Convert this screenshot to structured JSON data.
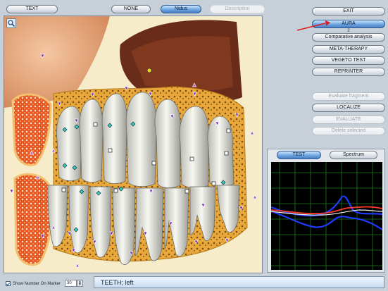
{
  "top_bar": {
    "text_button": "TEXT",
    "none_button": "NONE",
    "nidus_button": "Nidus",
    "description_button": "Description"
  },
  "right_menu": {
    "exit": "EXIT",
    "aura": "AURA",
    "aura_badge": "2",
    "comparative": "Comparative analysis",
    "meta_therapy": "META-THERAPY",
    "vegeto_test": "VEGETO TEST",
    "reprinter": "REPRINTER",
    "evaluate_fragment": "Evaluate fragment",
    "localize": "LOCALIZE",
    "evaluate": "EVALUATE",
    "delete_selected": "Delete selected"
  },
  "graph_panel": {
    "test_tab": "TEST",
    "spectrum_tab": "Spectrum",
    "series_colors": {
      "blue": "#1f3bff",
      "red": "#ff3a2a",
      "white": "#f2f2f2",
      "grid": "#1f7a1f"
    }
  },
  "bottom": {
    "show_number_label": "Show Number On Marker",
    "marker_count": "30",
    "status_text": "TEETH; left"
  },
  "icons": {
    "zoom": "magnifier-icon",
    "arrow": "annotation-arrow-icon",
    "markers": [
      "triangle-marker-icon",
      "square-marker-icon",
      "diamond-marker-icon"
    ]
  },
  "accent": "#2f6fc0"
}
